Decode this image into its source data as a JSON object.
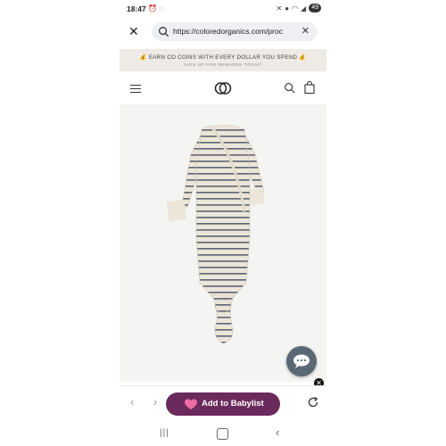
{
  "status_bar": {
    "time": "18:47",
    "left_icons": [
      "alarm-icon",
      "whatsapp-icon"
    ],
    "right_icons": [
      "mute-icon",
      "location-icon",
      "wifi-icon",
      "signal-icon"
    ],
    "battery": "49"
  },
  "browser": {
    "url": "https://coloredorganics.com/proc"
  },
  "promo": {
    "main": "💰 EARN CO COINS WITH EVERY DOLLAR YOU SPEND 💰",
    "sub": "SIGN UP FOR REWARDS TODAY!"
  },
  "header": {
    "logo": "colored-organics-logo"
  },
  "product": {
    "image": "striped-knotted-baby-gown"
  },
  "toolbar": {
    "babylist_label": "Add to Babylist",
    "back": "‹",
    "forward": "›"
  },
  "android_nav": {
    "recents": "|||",
    "back": "‹"
  },
  "colors": {
    "babylist": "#6b2a5c",
    "promo_bg": "#eeeae5",
    "chat": "#5a6876"
  }
}
